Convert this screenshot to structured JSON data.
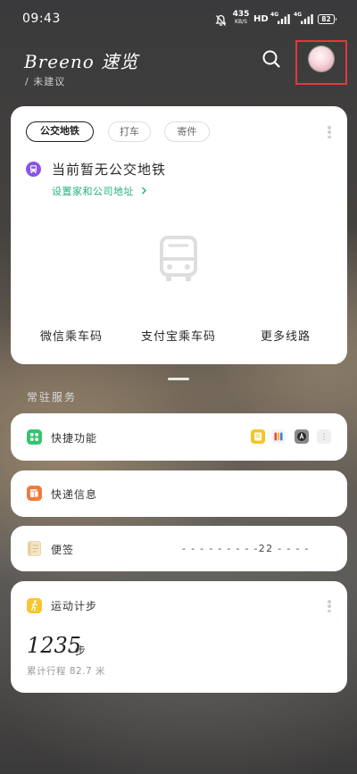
{
  "status_bar": {
    "time": "09:43",
    "net_speed": "435",
    "net_speed_unit": "KB/S",
    "hd_label": "HD",
    "sim1_label": "4G",
    "sim2_label": "4G",
    "battery_level": "82",
    "icons": [
      "bell-muted-icon",
      "signal-icon",
      "battery-icon"
    ]
  },
  "header": {
    "title": "Breeno 速览",
    "subtitle": "/ 未建议",
    "icons": [
      "search-icon",
      "avatar"
    ]
  },
  "transit_card": {
    "tabs": [
      {
        "label": "公交地铁",
        "selected": true
      },
      {
        "label": "打车",
        "selected": false
      },
      {
        "label": "寄件",
        "selected": false
      }
    ],
    "empty_message": "当前暂无公交地铁",
    "setup_link": "设置家和公司地址",
    "actions": [
      {
        "label": "微信乘车码"
      },
      {
        "label": "支付宝乘车码"
      },
      {
        "label": "更多线路"
      }
    ],
    "icons": [
      "bus-icon",
      "bus-placeholder-icon",
      "chevron-right-icon",
      "more-icon"
    ]
  },
  "resident_services": {
    "section_title": "常驻服务",
    "quick_functions": {
      "label": "快捷功能",
      "apps": [
        "notes-app-icon",
        "multicolor-app-icon",
        "dark-app-icon",
        "empty-slot-icon"
      ]
    },
    "express": {
      "label": "快递信息"
    },
    "notes": {
      "label": "便签",
      "preview": "- - - - - - - - -22 - - - -"
    },
    "steps": {
      "label": "运动计步",
      "count": "1235",
      "unit": "步",
      "distance": "累计行程 82.7 米"
    }
  },
  "colors": {
    "highlight_box": "#e0393e",
    "link": "#23b07c",
    "transit_icon": "#8b53e6",
    "quick_icon": "#35c46d",
    "express_icon": "#f5793a",
    "steps_icon": "#f7c532"
  }
}
